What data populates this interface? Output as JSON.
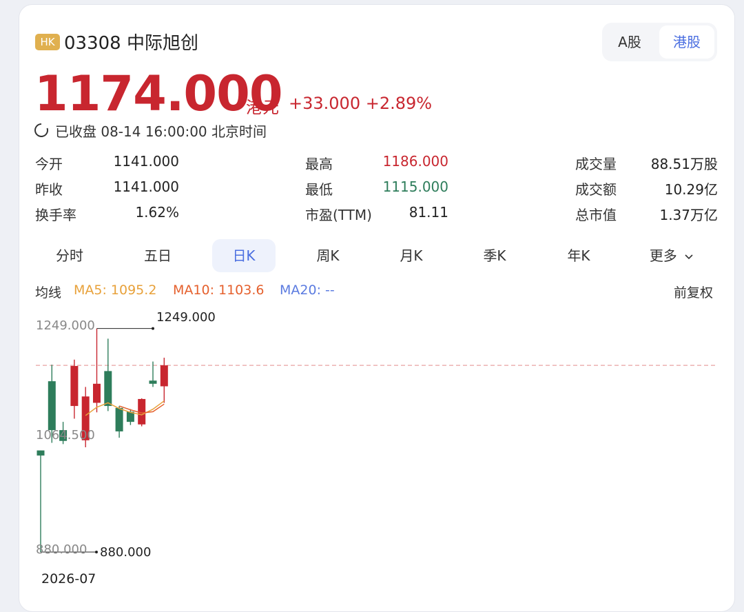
{
  "header": {
    "badge": "HK",
    "code_name": "03308 中际旭创",
    "market_toggle": {
      "a_share": "A股",
      "hk_share": "港股",
      "selected": "港股"
    }
  },
  "quote": {
    "price": "1174.000",
    "currency": "港元",
    "change": "+33.000 +2.89%",
    "status": "已收盘 08-14 16:00:00 北京时间"
  },
  "stats": {
    "open_label": "今开",
    "open_value": "1141.000",
    "prev_label": "昨收",
    "prev_value": "1141.000",
    "turnover_label": "换手率",
    "turnover_value": "1.62%",
    "high_label": "最高",
    "high_value": "1186.000",
    "low_label": "最低",
    "low_value": "1115.000",
    "pe_label": "市盈(TTM)",
    "pe_value": "81.11",
    "volume_label": "成交量",
    "volume_value": "88.51万股",
    "amount_label": "成交额",
    "amount_value": "10.29亿",
    "mktcap_label": "总市值",
    "mktcap_value": "1.37万亿"
  },
  "tabs": [
    "分时",
    "五日",
    "日K",
    "周K",
    "月K",
    "季K",
    "年K",
    "更多"
  ],
  "active_tab": "日K",
  "ma": {
    "label": "均线",
    "ma5": "MA5: 1095.2",
    "ma10": "MA10: 1103.6",
    "ma20": "MA20: --",
    "adjust": "前复权"
  },
  "colors": {
    "up": "#c8262f",
    "down": "#2e7d5b",
    "ma5": "#e8a13a",
    "ma10": "#e5602d",
    "ma20": "#5b7be0",
    "accent": "#4a6ee0"
  },
  "chart_data": {
    "type": "candlestick",
    "y_axis_labels": [
      "1249.000",
      "1064.500",
      "880.000"
    ],
    "ylim": [
      880,
      1249
    ],
    "max_annotation": "1249.000",
    "min_annotation": "880.000",
    "reference_line": 1174,
    "x_label": "2026-07",
    "candles": [
      {
        "open": 1040,
        "close": 1032,
        "high": 1040,
        "low": 880
      },
      {
        "open": 1149,
        "close": 1072,
        "high": 1175,
        "low": 1052
      },
      {
        "open": 1072,
        "close": 1055,
        "high": 1085,
        "low": 1050
      },
      {
        "open": 1110,
        "close": 1173,
        "high": 1183,
        "low": 1090
      },
      {
        "open": 1056,
        "close": 1125,
        "high": 1140,
        "low": 1045
      },
      {
        "open": 1115,
        "close": 1145,
        "high": 1232,
        "low": 1100
      },
      {
        "open": 1165,
        "close": 1110,
        "high": 1216,
        "low": 1102
      },
      {
        "open": 1107,
        "close": 1070,
        "high": 1110,
        "low": 1060
      },
      {
        "open": 1101,
        "close": 1085,
        "high": 1105,
        "low": 1080
      },
      {
        "open": 1081,
        "close": 1121,
        "high": 1122,
        "low": 1078
      },
      {
        "open": 1150,
        "close": 1145,
        "high": 1180,
        "low": 1140
      },
      {
        "open": 1141,
        "close": 1174,
        "high": 1186,
        "low": 1115
      }
    ],
    "ma5_line": [
      null,
      null,
      null,
      null,
      1095,
      1108,
      1115,
      1106,
      1100,
      1096,
      1105,
      1118
    ],
    "ma10_line": [
      null,
      null,
      null,
      null,
      null,
      null,
      null,
      1110,
      1104,
      1099,
      1101,
      1113
    ]
  }
}
